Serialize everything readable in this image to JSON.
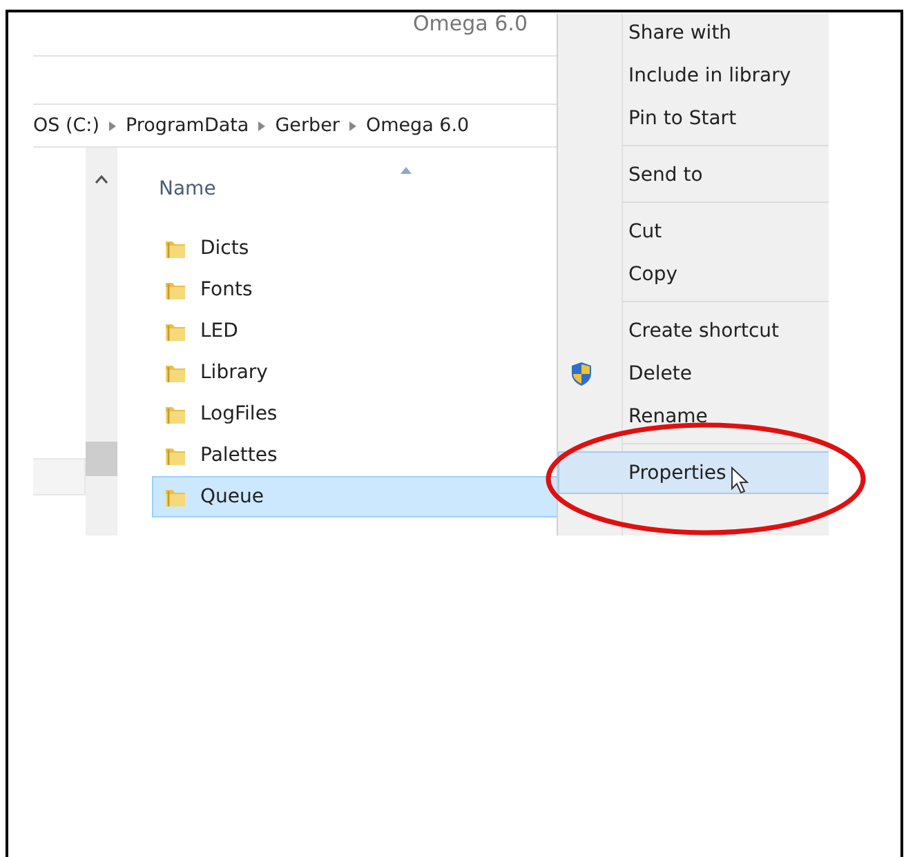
{
  "window": {
    "title": "Omega 6.0"
  },
  "breadcrumb": [
    "OS (C:)",
    "ProgramData",
    "Gerber",
    "Omega 6.0"
  ],
  "file_list": {
    "columns": [
      "Name"
    ],
    "rows": [
      {
        "name": "Dicts",
        "selected": false
      },
      {
        "name": "Fonts",
        "selected": false
      },
      {
        "name": "LED",
        "selected": false
      },
      {
        "name": "Library",
        "selected": false
      },
      {
        "name": "LogFiles",
        "selected": false
      },
      {
        "name": "Palettes",
        "selected": false
      },
      {
        "name": "Queue",
        "selected": true
      }
    ]
  },
  "context_menu": {
    "items": [
      {
        "kind": "item",
        "label": "Share with",
        "selected": false
      },
      {
        "kind": "item",
        "label": "Include in library",
        "selected": false
      },
      {
        "kind": "item",
        "label": "Pin to Start",
        "selected": false
      },
      {
        "kind": "separator"
      },
      {
        "kind": "item",
        "label": "Send to",
        "selected": false
      },
      {
        "kind": "separator"
      },
      {
        "kind": "item",
        "label": "Cut",
        "selected": false
      },
      {
        "kind": "item",
        "label": "Copy",
        "selected": false
      },
      {
        "kind": "separator"
      },
      {
        "kind": "item",
        "label": "Create shortcut",
        "selected": false
      },
      {
        "kind": "shielded",
        "label": "Delete",
        "selected": false
      },
      {
        "kind": "item",
        "label": "Rename",
        "selected": false
      },
      {
        "kind": "separator"
      },
      {
        "kind": "item",
        "label": "Properties",
        "selected": true,
        "pointer": true
      }
    ]
  }
}
